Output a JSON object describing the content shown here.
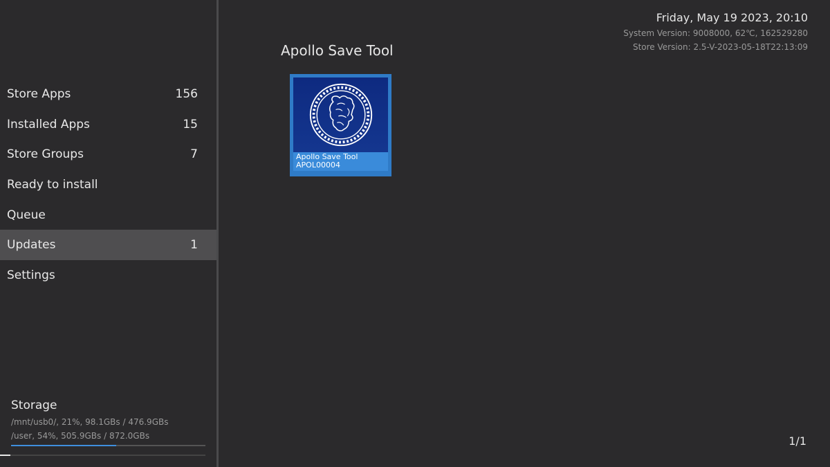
{
  "sidebar": {
    "items": [
      {
        "label": "Store Apps",
        "count": "156"
      },
      {
        "label": "Installed Apps",
        "count": "15"
      },
      {
        "label": "Store Groups",
        "count": "7"
      },
      {
        "label": "Ready to install",
        "count": ""
      },
      {
        "label": "Queue",
        "count": ""
      },
      {
        "label": "Updates",
        "count": "1"
      },
      {
        "label": "Settings",
        "count": ""
      }
    ],
    "selected_index": 5
  },
  "storage": {
    "title": "Storage",
    "usb_line": "/mnt/usb0/, 21%, 98.1GBs / 476.9GBs",
    "user_line": "/user, 54%, 505.9GBs / 872.0GBs",
    "user_used_percent": 54
  },
  "header": {
    "datetime": "Friday, May 19 2023, 20:10",
    "system_version": "System Version: 9008000, 62℃, 162529280",
    "store_version": "Store Version: 2.5-V-2023-05-18T22:13:09"
  },
  "main": {
    "section_title": "Apollo Save Tool",
    "tiles": [
      {
        "name": "Apollo Save Tool",
        "id": "APOL00004",
        "icon": "apollo-medallion-icon"
      }
    ],
    "pager": "1/1"
  },
  "colors": {
    "background": "#2b2a2c",
    "selected_row": "#4f4e50",
    "accent": "#3a8bda",
    "tile_art": "#14368f"
  }
}
